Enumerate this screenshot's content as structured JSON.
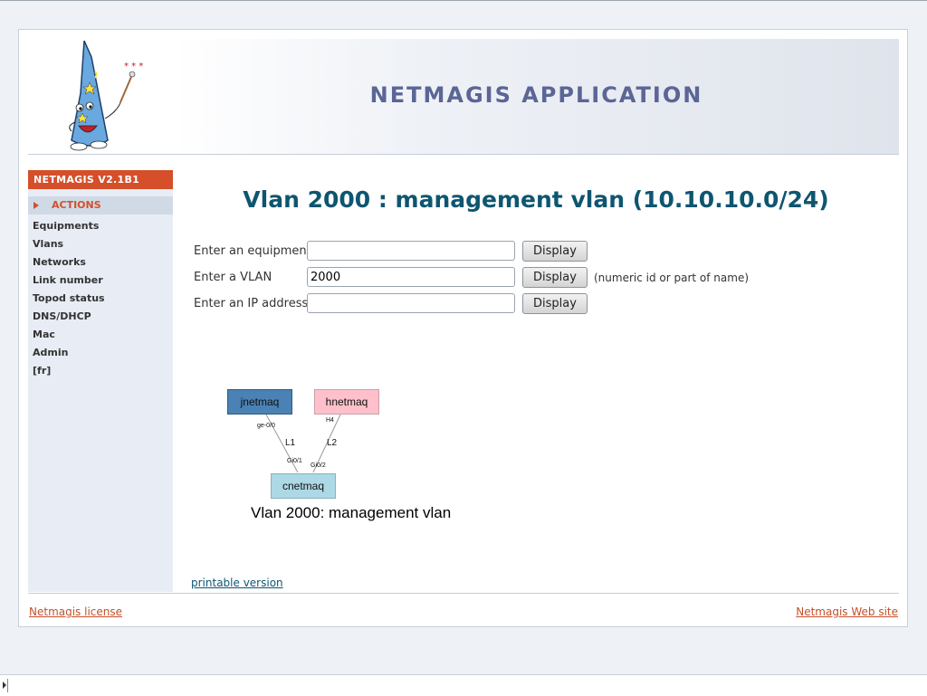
{
  "app": {
    "banner_title": "NETMAGIS APPLICATION"
  },
  "sidebar": {
    "version": "NETMAGIS V2.1B1",
    "section": "ACTIONS",
    "items": [
      {
        "label": "Equipments"
      },
      {
        "label": "Vlans"
      },
      {
        "label": "Networks"
      },
      {
        "label": "Link number"
      },
      {
        "label": "Topod status"
      },
      {
        "label": "DNS/DHCP"
      },
      {
        "label": "Mac"
      },
      {
        "label": "Admin"
      },
      {
        "label": "[fr]"
      }
    ]
  },
  "main": {
    "title": "Vlan 2000 : management vlan (10.10.10.0/24)",
    "form": {
      "equipment": {
        "label": "Enter an equipment",
        "value": "",
        "button": "Display"
      },
      "vlan": {
        "label": "Enter a VLAN",
        "value": "2000",
        "button": "Display",
        "hint": "(numeric id or part of name)"
      },
      "ip": {
        "label": "Enter an IP address",
        "value": "",
        "button": "Display"
      }
    },
    "graph": {
      "nodes": [
        {
          "name": "jnetmaq",
          "color": "#4a82b5"
        },
        {
          "name": "hnetmaq",
          "color": "#ffc0cb"
        },
        {
          "name": "cnetmaq",
          "color": "#add8e6"
        }
      ],
      "links": [
        {
          "label": "L1",
          "from_port": "ge-0/0",
          "to_port": "Gi0/1"
        },
        {
          "label": "L2",
          "from_port": "H4",
          "to_port": "Gi0/2"
        }
      ],
      "caption": "Vlan 2000: management vlan"
    },
    "printable_link": "printable version"
  },
  "footer": {
    "license_link": "Netmagis license",
    "website_link": "Netmagis Web site"
  },
  "colors": {
    "accent": "#d44f2a",
    "title": "#0e5670",
    "banner_text": "#5b6596",
    "sidebar_bg": "#e8edf5"
  }
}
